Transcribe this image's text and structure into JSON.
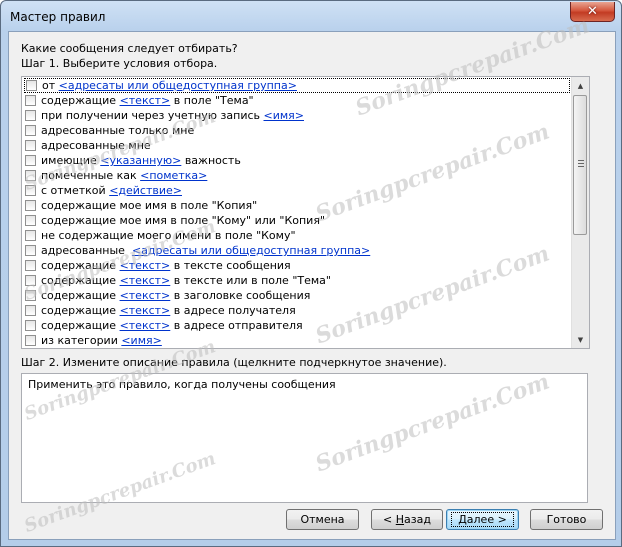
{
  "window": {
    "title": "Мастер правил",
    "close_glyph": "✕"
  },
  "step1": {
    "question": "Какие сообщения следует отбирать?",
    "label": "Шаг 1. Выберите условия отбора.",
    "conditions": [
      {
        "before": "от ",
        "link": "<адресаты или общедоступная группа>",
        "after": "",
        "selected": true
      },
      {
        "before": "содержащие ",
        "link": "<текст>",
        "after": " в поле \"Тема\""
      },
      {
        "before": "при получении через учетную запись ",
        "link": "<имя>",
        "after": ""
      },
      {
        "before": "адресованные только мне",
        "link": "",
        "after": ""
      },
      {
        "before": "адресованные мне",
        "link": "",
        "after": ""
      },
      {
        "before": "имеющие ",
        "link": "<указанную>",
        "after": " важность"
      },
      {
        "before": "помеченные как ",
        "link": "<пометка>",
        "after": ""
      },
      {
        "before": "с отметкой ",
        "link": "<действие>",
        "after": ""
      },
      {
        "before": "содержащие мое имя в поле \"Копия\"",
        "link": "",
        "after": ""
      },
      {
        "before": "содержащие мое имя в поле \"Кому\" или \"Копия\"",
        "link": "",
        "after": ""
      },
      {
        "before": "не содержащие моего имени в поле \"Кому\"",
        "link": "",
        "after": ""
      },
      {
        "before": "адресованные  ",
        "link": "<адресаты или общедоступная группа>",
        "after": ""
      },
      {
        "before": "содержащие ",
        "link": "<текст>",
        "after": " в тексте сообщения"
      },
      {
        "before": "содержащие ",
        "link": "<текст>",
        "after": " в тексте или в поле \"Тема\""
      },
      {
        "before": "содержащие ",
        "link": "<текст>",
        "after": " в заголовке сообщения"
      },
      {
        "before": "содержащие ",
        "link": "<текст>",
        "after": " в адресе получателя"
      },
      {
        "before": "содержащие ",
        "link": "<текст>",
        "after": " в адресе отправителя"
      },
      {
        "before": "из категории ",
        "link": "<имя>",
        "after": ""
      }
    ]
  },
  "step2": {
    "label": "Шаг 2. Измените описание правила (щелкните подчеркнутое значение).",
    "description": "Применить это правило, когда получены сообщения"
  },
  "buttons": {
    "cancel": "Отмена",
    "back_arrow": "< ",
    "back_hotkey": "Н",
    "back_rest": "азад",
    "next_hotkey": "Д",
    "next_rest": "алее >",
    "finish": "Готово"
  },
  "watermark": "Soringpcrepair.Com",
  "scrollbar": {
    "up_glyph": "▲",
    "down_glyph": "▼"
  }
}
